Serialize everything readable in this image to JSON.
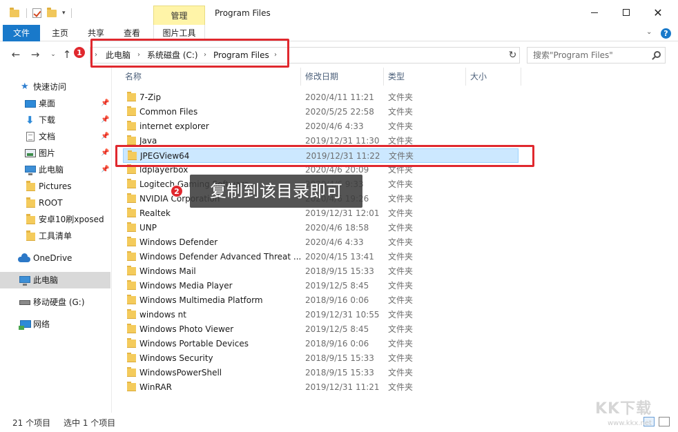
{
  "window": {
    "title": "Program Files",
    "contextual_tab": "管理",
    "close_glyph": "✕"
  },
  "ribbon": {
    "tabs": [
      "文件",
      "主页",
      "共享",
      "查看",
      "图片工具"
    ]
  },
  "address": {
    "breadcrumb": [
      "此电脑",
      "系统磁盘 (C:)",
      "Program Files"
    ],
    "search_placeholder": "搜索\"Program Files\""
  },
  "nav": {
    "items": [
      {
        "label": "快速访问",
        "icon": "star-icon"
      },
      {
        "label": "桌面",
        "icon": "desktop-icon",
        "pinned": true
      },
      {
        "label": "下载",
        "icon": "download-icon",
        "pinned": true
      },
      {
        "label": "文档",
        "icon": "document-icon",
        "pinned": true
      },
      {
        "label": "图片",
        "icon": "picture-icon",
        "pinned": true
      },
      {
        "label": "此电脑",
        "icon": "computer-icon",
        "pinned": true
      },
      {
        "label": "Pictures",
        "icon": "folder-icon"
      },
      {
        "label": "ROOT",
        "icon": "folder-icon"
      },
      {
        "label": "安卓10刷xposed",
        "icon": "folder-icon"
      },
      {
        "label": "工具清单",
        "icon": "folder-icon"
      },
      {
        "label": "OneDrive",
        "icon": "cloud-icon"
      },
      {
        "label": "此电脑",
        "icon": "computer-icon",
        "selected": true
      },
      {
        "label": "移动硬盘 (G:)",
        "icon": "drive-icon"
      },
      {
        "label": "网络",
        "icon": "network-icon"
      }
    ]
  },
  "columns": [
    "名称",
    "修改日期",
    "类型",
    "大小"
  ],
  "files": [
    {
      "name": "7-Zip",
      "date": "2020/4/11 11:21",
      "type": "文件夹"
    },
    {
      "name": "Common Files",
      "date": "2020/5/25 22:58",
      "type": "文件夹"
    },
    {
      "name": "internet explorer",
      "date": "2020/4/6 4:33",
      "type": "文件夹"
    },
    {
      "name": "Java",
      "date": "2019/12/31 11:30",
      "type": "文件夹"
    },
    {
      "name": "JPEGView64",
      "date": "2019/12/31 11:22",
      "type": "文件夹",
      "selected": true
    },
    {
      "name": "ldplayerbox",
      "date": "2020/4/6 20:09",
      "type": "文件夹"
    },
    {
      "name": "Logitech Gaming Software",
      "date": "2020/4/6 9:33",
      "type": "文件夹"
    },
    {
      "name": "NVIDIA Corporation",
      "date": "2020/4/6 19:26",
      "type": "文件夹"
    },
    {
      "name": "Realtek",
      "date": "2019/12/31 12:01",
      "type": "文件夹"
    },
    {
      "name": "UNP",
      "date": "2020/4/6 18:58",
      "type": "文件夹"
    },
    {
      "name": "Windows Defender",
      "date": "2020/4/6 4:33",
      "type": "文件夹"
    },
    {
      "name": "Windows Defender Advanced Threat ...",
      "date": "2020/4/15 13:41",
      "type": "文件夹"
    },
    {
      "name": "Windows Mail",
      "date": "2018/9/15 15:33",
      "type": "文件夹"
    },
    {
      "name": "Windows Media Player",
      "date": "2019/12/5 8:45",
      "type": "文件夹"
    },
    {
      "name": "Windows Multimedia Platform",
      "date": "2018/9/16 0:06",
      "type": "文件夹"
    },
    {
      "name": "windows nt",
      "date": "2019/12/31 10:55",
      "type": "文件夹"
    },
    {
      "name": "Windows Photo Viewer",
      "date": "2019/12/5 8:45",
      "type": "文件夹"
    },
    {
      "name": "Windows Portable Devices",
      "date": "2018/9/16 0:06",
      "type": "文件夹"
    },
    {
      "name": "Windows Security",
      "date": "2018/9/15 15:33",
      "type": "文件夹"
    },
    {
      "name": "WindowsPowerShell",
      "date": "2018/9/15 15:33",
      "type": "文件夹"
    },
    {
      "name": "WinRAR",
      "date": "2019/12/31 11:21",
      "type": "文件夹"
    }
  ],
  "status": {
    "count": "21 个项目",
    "selected": "选中 1 个项目"
  },
  "annotations": {
    "badge1": "1",
    "badge2": "2",
    "tooltip": "复制到该目录即可"
  },
  "watermark": {
    "main": "KK下载",
    "sub": "www.kkx.net"
  },
  "colors": {
    "accent": "#1979ca",
    "selection": "#cce8ff",
    "annotation_red": "#e0282e"
  }
}
